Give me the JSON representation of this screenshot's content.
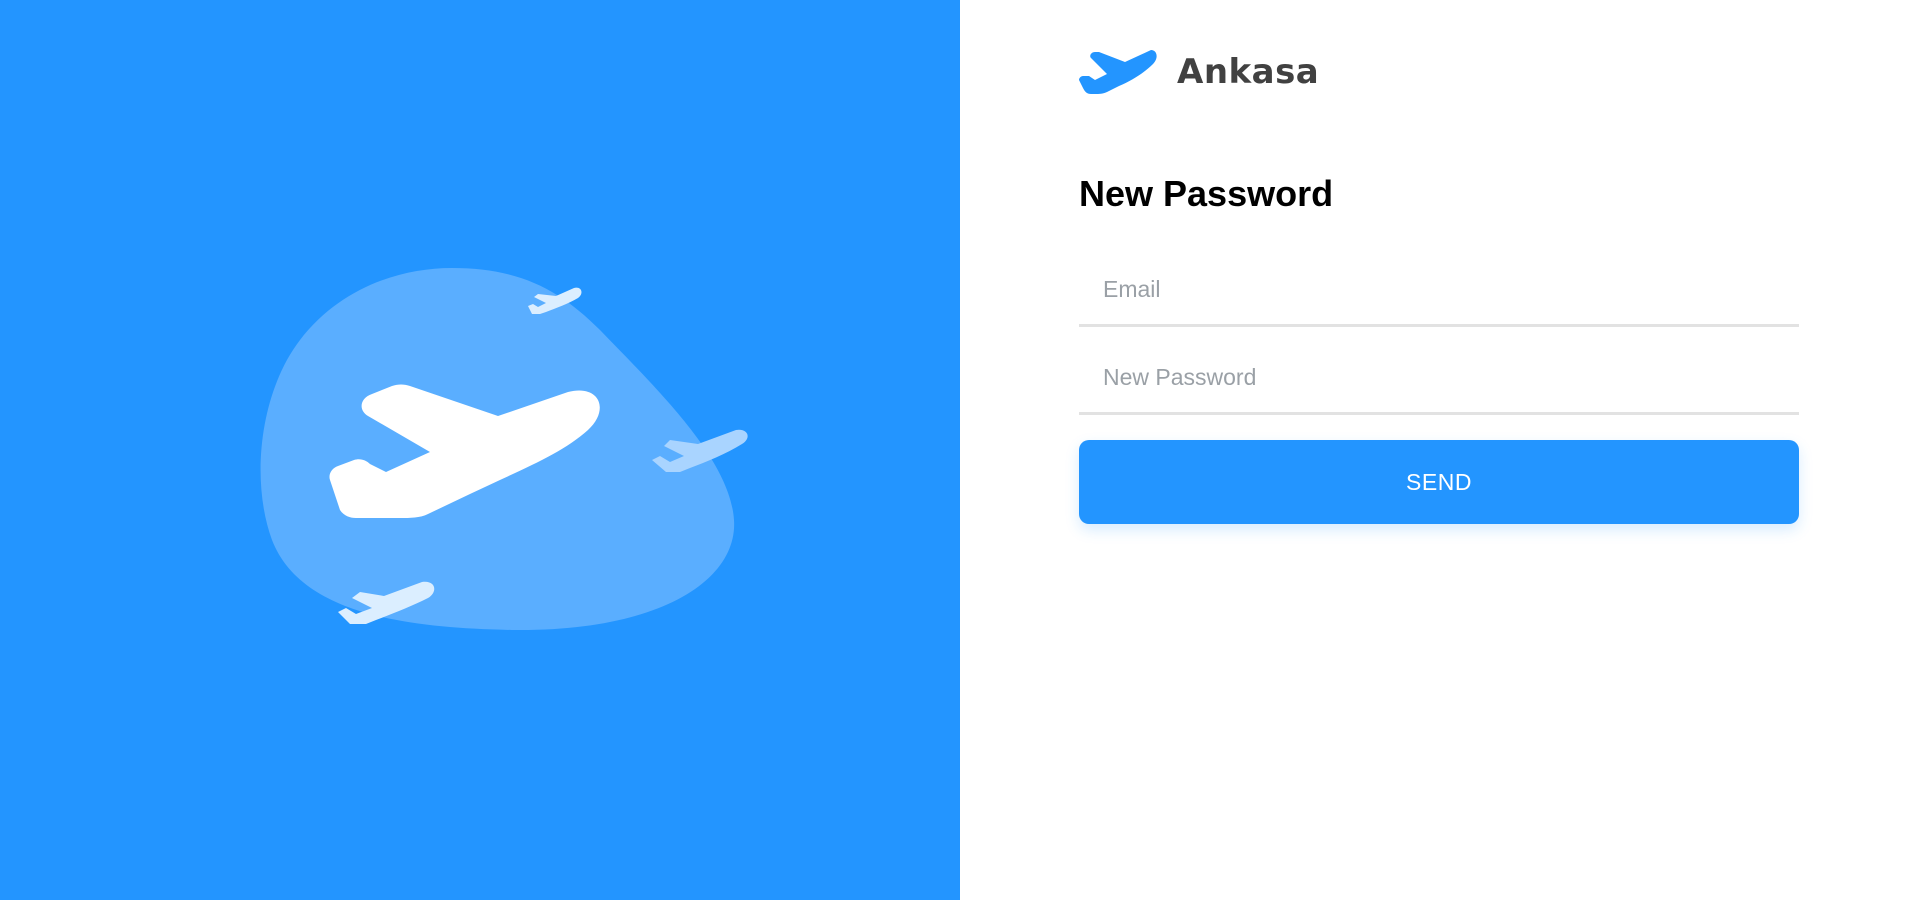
{
  "brand": {
    "name": "Ankasa",
    "icon": "plane-icon",
    "color": "#2395FF"
  },
  "hero": {
    "background": "#2395FF",
    "blob_color": "#5AAEFF",
    "icons": [
      "large-plane-icon",
      "small-plane-icon"
    ]
  },
  "form": {
    "title": "New Password",
    "email": {
      "value": "",
      "placeholder": "Email"
    },
    "password": {
      "value": "",
      "placeholder": "New Password"
    },
    "submit_label": "SEND"
  }
}
